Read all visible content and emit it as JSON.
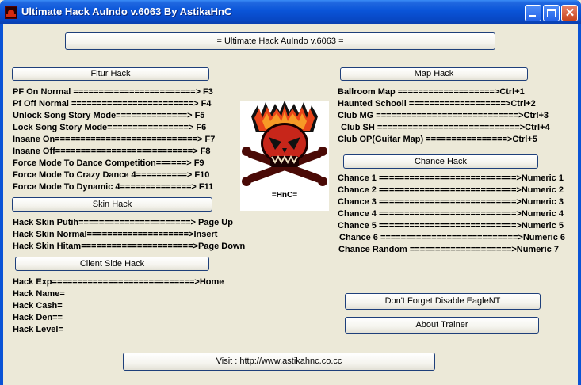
{
  "window": {
    "title": "Ultimate Hack AuIndo v.6063 By AstikaHnC",
    "close_glyph": "✕"
  },
  "banner_button": "= Ultimate Hack AuIndo v.6063 =",
  "fitur": {
    "button": "Fitur Hack",
    "lines": [
      "PF On Normal ========================> F3",
      "Pf Off Normal ========================> F4",
      "Unlock Song Story Mode==============> F5",
      "Lock Song Story Mode================> F6",
      "Insane On============================> F7",
      "Insane Off===========================> F8",
      "Force Mode To Dance Competition======> F9",
      "Force Mode To Crazy Dance 4==========> F10",
      "Force Mode To Dynamic 4==============> F11"
    ]
  },
  "skin": {
    "button": "Skin Hack",
    "lines": [
      "Hack Skin Putih======================> Page Up",
      "Hack Skin Normal====================>Insert",
      "Hack Skin Hitam======================>Page Down"
    ]
  },
  "client_side": {
    "button": "Client Side Hack",
    "lines": [
      "Hack Exp============================>Home",
      "Hack Name=",
      "Hack Cash=",
      "Hack Den==",
      "Hack Level="
    ]
  },
  "logo": {
    "caption": "=HnC="
  },
  "map": {
    "button": "Map Hack",
    "lines": [
      "Ballroom Map ===================>Ctrl+1",
      "Haunted Schooll ===================>Ctrl+2",
      "Club MG ============================>Ctrl+3",
      "Club SH ============================>Ctrl+4",
      "Club OP(Guitar Map) ================>Ctrl+5"
    ]
  },
  "chance": {
    "button": "Chance Hack",
    "lines": [
      "Chance 1 ===========================>Numeric 1",
      "Chance 2 ===========================>Numeric 2",
      "Chance 3 ===========================>Numeric 3",
      "Chance 4 ===========================>Numeric 4",
      "Chance 5 ===========================>Numeric 5",
      "Chance 6 ===========================>Numeric 6",
      "Chance Random ====================>Numeric 7"
    ]
  },
  "eagle_button": "Don't Forget Disable EagleNT",
  "about_button": "About Trainer",
  "visit_button": "Visit : http://www.astikahnc.co.cc"
}
